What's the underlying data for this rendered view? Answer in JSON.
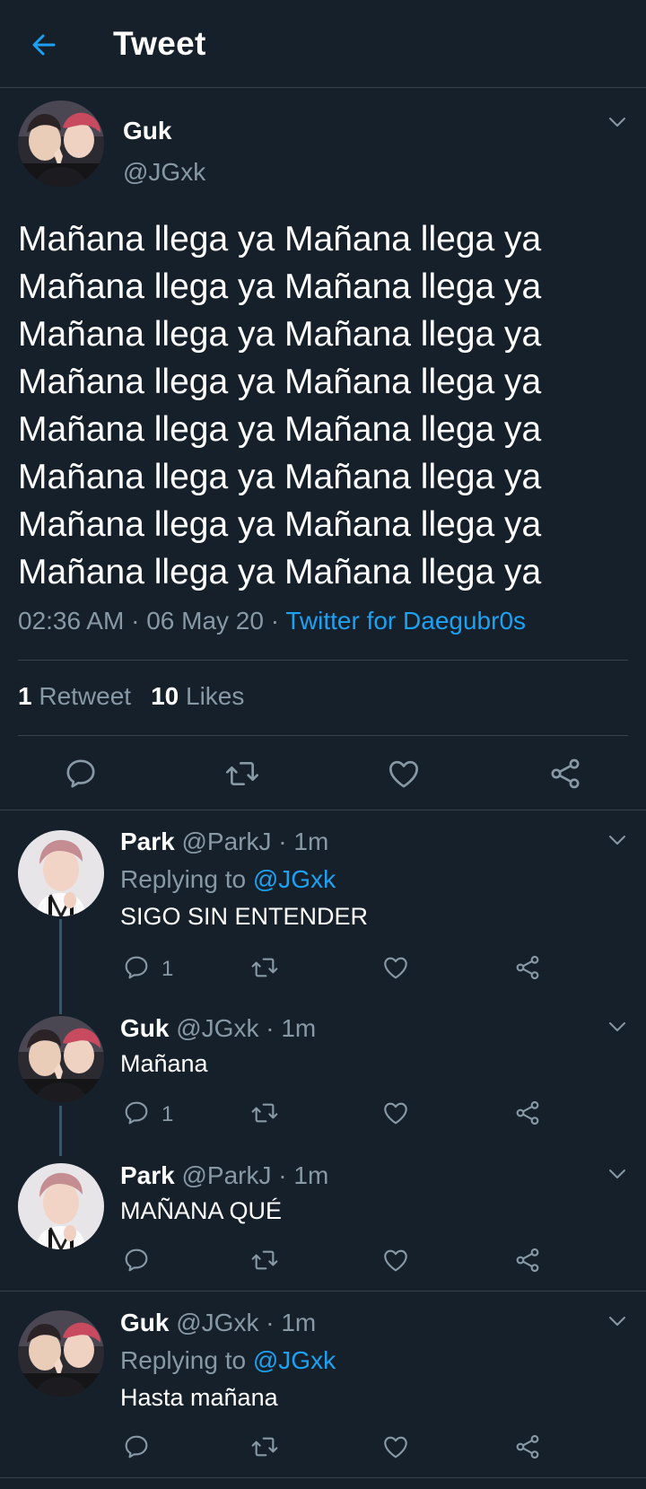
{
  "header": {
    "title": "Tweet"
  },
  "main_tweet": {
    "name": "Guk",
    "handle": "@JGxk",
    "text_lines": [
      "Mañana llega ya Mañana llega ya",
      "Mañana llega ya Mañana llega ya",
      "Mañana llega ya Mañana llega ya",
      "Mañana llega ya Mañana llega ya",
      "Mañana llega ya Mañana llega ya",
      "Mañana llega ya Mañana llega ya",
      "Mañana llega ya Mañana llega ya",
      "Mañana llega ya Mañana llega ya"
    ],
    "time": "02:36 AM",
    "date": "06 May 20",
    "source": "Twitter for Daegubr0s",
    "retweets": "1",
    "retweets_label": "Retweet",
    "likes": "10",
    "likes_label": "Likes"
  },
  "replies": [
    {
      "name": "Park",
      "handle": "@ParkJ",
      "time": "1m",
      "replying_label": "Replying to",
      "replying_to": "@JGxk",
      "text": "SIGO SIN ENTENDER",
      "reply_count": "1"
    },
    {
      "name": "Guk",
      "handle": "@JGxk",
      "time": "1m",
      "text": "Mañana",
      "reply_count": "1"
    },
    {
      "name": "Park",
      "handle": "@ParkJ",
      "time": "1m",
      "text": "MAÑANA QUÉ"
    },
    {
      "name": "Guk",
      "handle": "@JGxk",
      "time": "1m",
      "replying_label": "Replying to",
      "replying_to": "@JGxk",
      "text": "Hasta mañana"
    }
  ],
  "colors": {
    "background": "#15202b",
    "accent": "#1da1f2",
    "muted": "#8899a6",
    "border": "#38444d"
  },
  "icons": [
    "back-arrow-icon",
    "chevron-down-icon",
    "reply-icon",
    "retweet-icon",
    "like-icon",
    "share-icon"
  ]
}
